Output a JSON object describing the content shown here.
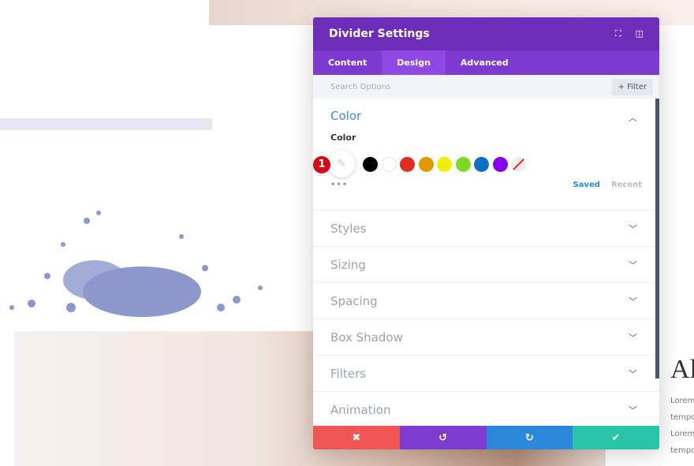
{
  "background": {
    "side_heading": "Al",
    "side_lines": [
      "Lorem",
      "tempo",
      "Lorem",
      "tempo"
    ]
  },
  "modal": {
    "title": "Divider Settings",
    "icons": [
      "fullscreen-icon",
      "sidebar-icon"
    ],
    "tabs": [
      {
        "label": "Content"
      },
      {
        "label": "Design",
        "active": true
      },
      {
        "label": "Advanced"
      }
    ],
    "search_placeholder": "Search Options",
    "filter_label": "+ Filter",
    "color_section": {
      "title": "Color",
      "field_label": "Color",
      "badge": "1",
      "swatches": [
        "#000000",
        "#ffffff",
        "#e02b20",
        "#e09900",
        "#edf000",
        "#7cda24",
        "#0c71c3",
        "#8300e9",
        "none"
      ],
      "more": "•••",
      "saved": "Saved",
      "recent": "Recent"
    },
    "sections": [
      "Styles",
      "Sizing",
      "Spacing",
      "Box Shadow",
      "Filters",
      "Animation"
    ],
    "footer": {
      "cancel": "✖",
      "undo": "↺",
      "redo": "↻",
      "save": "✔",
      "colors": [
        "#ef5555",
        "#7e3bd0",
        "#2b87da",
        "#29c4a9"
      ]
    }
  }
}
